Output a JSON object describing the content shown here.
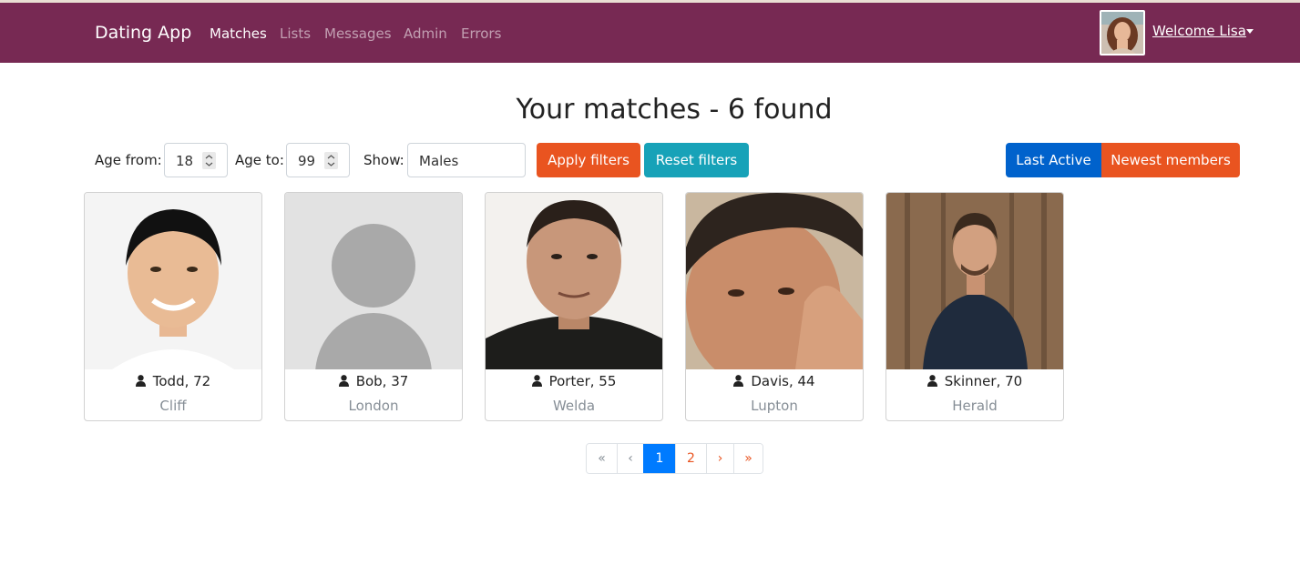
{
  "navbar": {
    "brand": "Dating App",
    "links": [
      "Matches",
      "Lists",
      "Messages",
      "Admin",
      "Errors"
    ],
    "active": "Matches",
    "welcome": "Welcome Lisa",
    "color": "#772953"
  },
  "page": {
    "title": "Your matches - 6 found"
  },
  "filters": {
    "age_from_label": "Age from:",
    "age_from_value": "18",
    "age_to_label": "Age to:",
    "age_to_value": "99",
    "show_label": "Show:",
    "show_value": "Males",
    "apply_label": "Apply filters",
    "reset_label": "Reset filters",
    "last_active_label": "Last Active",
    "newest_label": "Newest members"
  },
  "members": [
    {
      "name": "Todd, 72",
      "city": "Cliff",
      "photo": "photo"
    },
    {
      "name": "Bob, 37",
      "city": "London",
      "photo": "placeholder-avatar"
    },
    {
      "name": "Porter, 55",
      "city": "Welda",
      "photo": "photo"
    },
    {
      "name": "Davis, 44",
      "city": "Lupton",
      "photo": "photo"
    },
    {
      "name": "Skinner, 70",
      "city": "Herald",
      "photo": "photo"
    }
  ],
  "pagination": {
    "items": [
      "«",
      "‹",
      "1",
      "2",
      "›",
      "»"
    ],
    "current": "1"
  },
  "colors": {
    "primary": "#e95420",
    "info": "#17a2b8",
    "blue": "#0062cc",
    "page_active": "#007bff"
  }
}
